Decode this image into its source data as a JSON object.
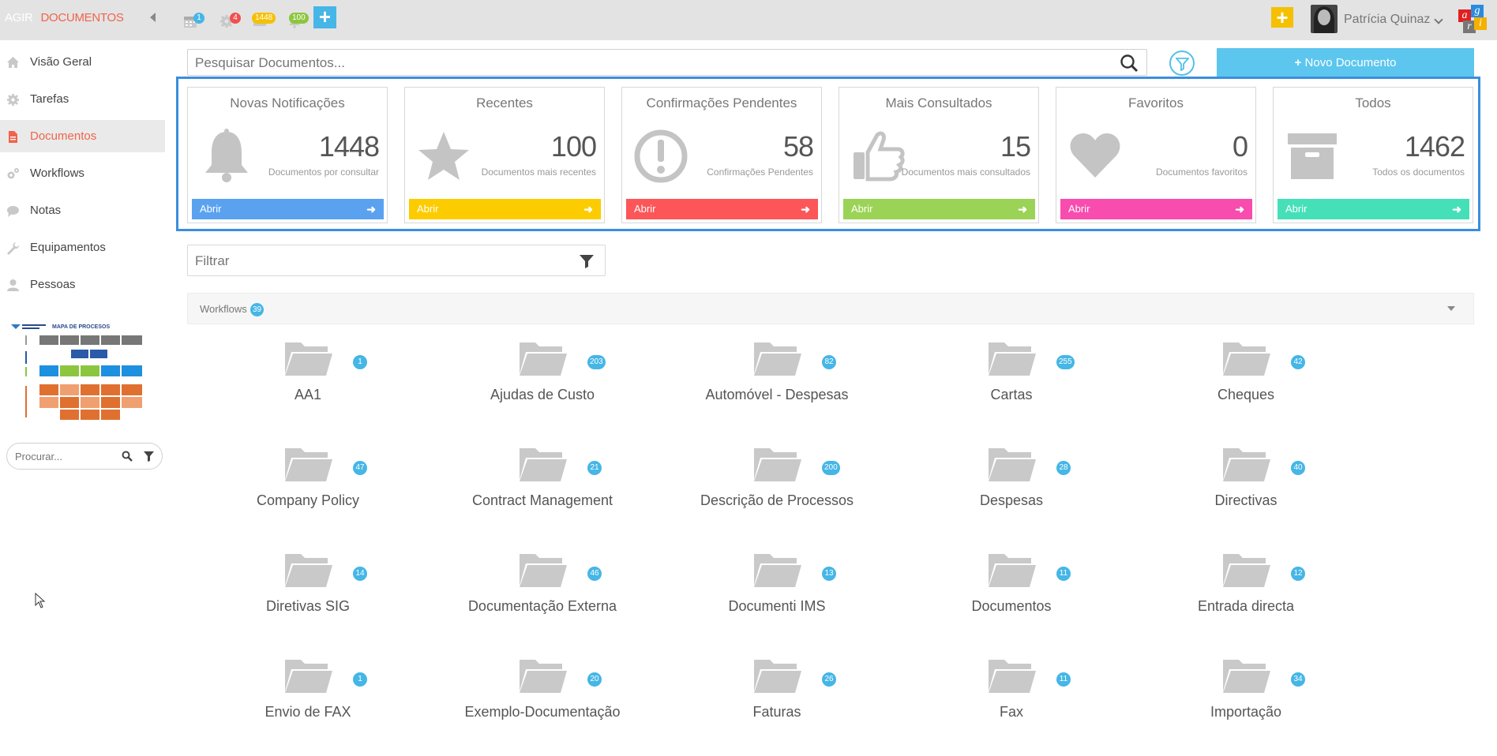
{
  "topbar": {
    "brand_app": "AGIR",
    "brand_module": "DOCUMENTOS",
    "badges": [
      {
        "icon": "calendar-icon",
        "count": "1",
        "color": "#45b6e6"
      },
      {
        "icon": "gear-icon",
        "count": "4",
        "color": "#f05050"
      },
      {
        "icon": "message-icon",
        "count": "1448",
        "color": "#f5c000"
      },
      {
        "icon": "bell-icon",
        "count": "100",
        "color": "#8cc63e"
      }
    ],
    "add_label": "+",
    "quick_add_label": "+",
    "user_name": "Patrícia Quinaz",
    "logo_letters": [
      "a",
      "g",
      "r",
      "i"
    ]
  },
  "sidebar": {
    "items": [
      {
        "label": "Visão Geral",
        "icon": "home-icon",
        "active": false
      },
      {
        "label": "Tarefas",
        "icon": "gear-icon",
        "active": false
      },
      {
        "label": "Documentos",
        "icon": "document-icon",
        "active": true
      },
      {
        "label": "Workflows",
        "icon": "gears-icon",
        "active": false
      },
      {
        "label": "Notas",
        "icon": "chat-icon",
        "active": false
      },
      {
        "label": "Equipamentos",
        "icon": "wrench-icon",
        "active": false
      },
      {
        "label": "Pessoas",
        "icon": "user-icon",
        "active": false
      }
    ],
    "process_map_title": "MAPA DE PROCESOS",
    "search_placeholder": "Procurar..."
  },
  "main": {
    "search_placeholder": "Pesquisar Documentos...",
    "new_document_label": "Novo Documento",
    "filter_placeholder": "Filtrar",
    "cards": [
      {
        "title": "Novas Notificações",
        "count": "1448",
        "subtitle": "Documentos por consultar",
        "button": "Abrir",
        "color": "#5aa2f0",
        "icon": "bell-icon"
      },
      {
        "title": "Recentes",
        "count": "100",
        "subtitle": "Documentos mais recentes",
        "button": "Abrir",
        "color": "#fccc00",
        "icon": "star-icon"
      },
      {
        "title": "Confirmações Pendentes",
        "count": "58",
        "subtitle": "Confirmações Pendentes",
        "button": "Abrir",
        "color": "#fc5658",
        "icon": "exclamation-icon"
      },
      {
        "title": "Mais Consultados",
        "count": "15",
        "subtitle": "Documentos mais consultados",
        "button": "Abrir",
        "color": "#9bd356",
        "icon": "thumbs-up-icon"
      },
      {
        "title": "Favoritos",
        "count": "0",
        "subtitle": "Documentos favoritos",
        "button": "Abrir",
        "color": "#f84cae",
        "icon": "heart-icon"
      },
      {
        "title": "Todos",
        "count": "1462",
        "subtitle": "Todos os documentos",
        "button": "Abrir",
        "color": "#45e0b8",
        "icon": "archive-icon"
      }
    ],
    "workflows": {
      "label": "Workflows",
      "count": "39"
    },
    "folders": [
      {
        "name": "AA1",
        "count": "1"
      },
      {
        "name": "Ajudas de Custo",
        "count": "203"
      },
      {
        "name": "Automóvel - Despesas",
        "count": "82"
      },
      {
        "name": "Cartas",
        "count": "255"
      },
      {
        "name": "Cheques",
        "count": "42"
      },
      {
        "name": "Company Policy",
        "count": "47"
      },
      {
        "name": "Contract Management",
        "count": "21"
      },
      {
        "name": "Descrição de Processos",
        "count": "200"
      },
      {
        "name": "Despesas",
        "count": "28"
      },
      {
        "name": "Directivas",
        "count": "40"
      },
      {
        "name": "Diretivas SIG",
        "count": "14"
      },
      {
        "name": "Documentação Externa",
        "count": "46"
      },
      {
        "name": "Documenti IMS",
        "count": "13"
      },
      {
        "name": "Documentos",
        "count": "11"
      },
      {
        "name": "Entrada directa",
        "count": "12"
      },
      {
        "name": "Envio de FAX",
        "count": "1"
      },
      {
        "name": "Exemplo-Documentação",
        "count": "20"
      },
      {
        "name": "Faturas",
        "count": "26"
      },
      {
        "name": "Fax",
        "count": "11"
      },
      {
        "name": "Importação",
        "count": "34"
      }
    ]
  }
}
